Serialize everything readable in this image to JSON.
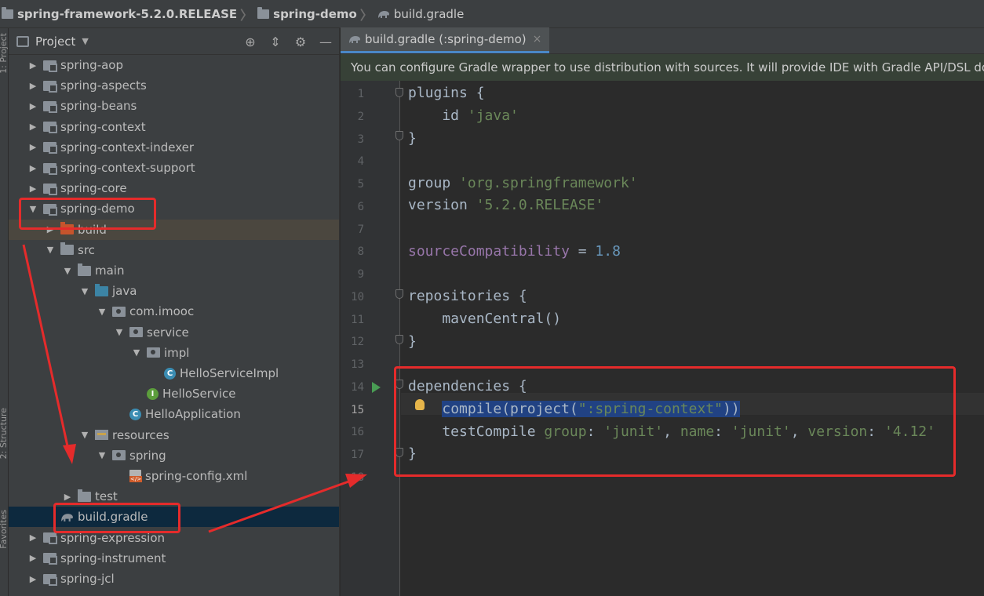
{
  "breadcrumb": {
    "items": [
      "spring-framework-5.2.0.RELEASE",
      "spring-demo",
      "build.gradle"
    ]
  },
  "left_strip": {
    "labels": [
      "1: Project",
      "2: Structure",
      "Favorites"
    ]
  },
  "project_panel": {
    "title": "Project",
    "tools": [
      "locate-icon",
      "collapse-icon",
      "gear-icon",
      "hide-icon"
    ],
    "tree": [
      {
        "label": "spring-aop",
        "icon": "module",
        "arrow": "collapsed",
        "indent": 0
      },
      {
        "label": "spring-aspects",
        "icon": "module",
        "arrow": "collapsed",
        "indent": 0
      },
      {
        "label": "spring-beans",
        "icon": "module",
        "arrow": "collapsed",
        "indent": 0
      },
      {
        "label": "spring-context",
        "icon": "module",
        "arrow": "collapsed",
        "indent": 0
      },
      {
        "label": "spring-context-indexer",
        "icon": "module",
        "arrow": "collapsed",
        "indent": 0
      },
      {
        "label": "spring-context-support",
        "icon": "module",
        "arrow": "collapsed",
        "indent": 0
      },
      {
        "label": "spring-core",
        "icon": "module",
        "arrow": "collapsed",
        "indent": 0
      },
      {
        "label": "spring-demo",
        "icon": "module",
        "arrow": "expanded",
        "indent": 0
      },
      {
        "label": "build",
        "icon": "folder-orange",
        "arrow": "collapsed",
        "indent": 1
      },
      {
        "label": "src",
        "icon": "folder",
        "arrow": "expanded",
        "indent": 1
      },
      {
        "label": "main",
        "icon": "folder",
        "arrow": "expanded",
        "indent": 2
      },
      {
        "label": "java",
        "icon": "folder-blue",
        "arrow": "expanded",
        "indent": 3
      },
      {
        "label": "com.imooc",
        "icon": "package",
        "arrow": "expanded",
        "indent": 4
      },
      {
        "label": "service",
        "icon": "package",
        "arrow": "expanded",
        "indent": 5
      },
      {
        "label": "impl",
        "icon": "package",
        "arrow": "expanded",
        "indent": 6
      },
      {
        "label": "HelloServiceImpl",
        "icon": "class",
        "arrow": "none",
        "indent": 7
      },
      {
        "label": "HelloService",
        "icon": "interface",
        "arrow": "none",
        "indent": 6
      },
      {
        "label": "HelloApplication",
        "icon": "app",
        "arrow": "none",
        "indent": 5
      },
      {
        "label": "resources",
        "icon": "resources",
        "arrow": "expanded",
        "indent": 3
      },
      {
        "label": "spring",
        "icon": "package",
        "arrow": "expanded",
        "indent": 4
      },
      {
        "label": "spring-config.xml",
        "icon": "xml",
        "arrow": "none",
        "indent": 5
      },
      {
        "label": "test",
        "icon": "folder",
        "arrow": "collapsed",
        "indent": 2
      },
      {
        "label": "build.gradle",
        "icon": "gradle",
        "arrow": "none",
        "indent": 1
      },
      {
        "label": "spring-expression",
        "icon": "module",
        "arrow": "collapsed",
        "indent": 0
      },
      {
        "label": "spring-instrument",
        "icon": "module",
        "arrow": "collapsed",
        "indent": 0
      },
      {
        "label": "spring-jcl",
        "icon": "module",
        "arrow": "collapsed",
        "indent": 0
      }
    ]
  },
  "editor": {
    "tab_label": "build.gradle (:spring-demo)",
    "tab_close": "×",
    "notice": "You can configure Gradle wrapper to use distribution with sources. It will provide IDE with Gradle API/DSL docu",
    "line_numbers": [
      "1",
      "2",
      "3",
      "4",
      "5",
      "6",
      "7",
      "8",
      "9",
      "10",
      "11",
      "12",
      "13",
      "14",
      "15",
      "16",
      "17",
      "18"
    ],
    "current_line": 15,
    "code": {
      "l1": "plugins {",
      "l2_a": "    id ",
      "l2_b": "'java'",
      "l3": "}",
      "l5_a": "group ",
      "l5_b": "'org.springframework'",
      "l6_a": "version ",
      "l6_b": "'5.2.0.RELEASE'",
      "l8_a": "sourceCompatibility",
      "l8_b": " = ",
      "l8_c": "1.8",
      "l10": "repositories {",
      "l11": "    mavenCentral()",
      "l12": "}",
      "l14": "dependencies {",
      "l15_indent": "    ",
      "l15_a": "compile(project(",
      "l15_b": "\":spring-context\"",
      "l15_c": "))",
      "l16_a": "    testCompile ",
      "l16_b": "group",
      "l16_c": ": ",
      "l16_d": "'junit'",
      "l16_e": ", ",
      "l16_f": "name",
      "l16_g": ": ",
      "l16_h": "'junit'",
      "l16_i": ", ",
      "l16_j": "version",
      "l16_k": ": ",
      "l16_l": "'4.12'",
      "l17": "}"
    }
  },
  "colors": {
    "annotation_red": "#e52b2b",
    "selection_blue": "#214283",
    "string_green": "#6a8759",
    "number_blue": "#6897bb",
    "property_purple": "#9876aa"
  }
}
